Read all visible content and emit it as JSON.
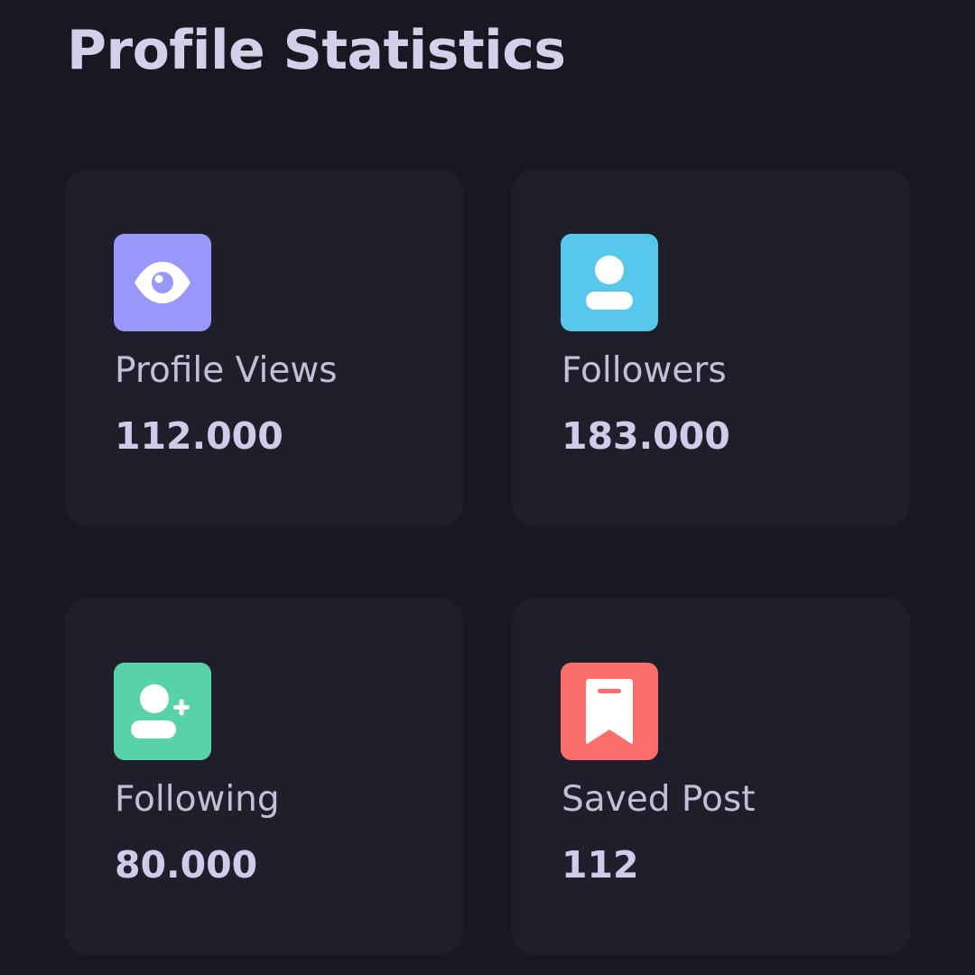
{
  "page": {
    "title": "Profile Statistics"
  },
  "theme": {
    "background": "#181822",
    "card_background": "#1f1f2c",
    "text_primary": "#cfccea",
    "text_secondary": "#c2bfd6"
  },
  "stats": [
    {
      "label": "Profile Views",
      "value": "112.000",
      "icon": "eye-icon",
      "color": "#9a97fb"
    },
    {
      "label": "Followers",
      "value": "183.000",
      "icon": "user-icon",
      "color": "#57c7ec"
    },
    {
      "label": "Following",
      "value": "80.000",
      "icon": "user-plus-icon",
      "color": "#58d3a9"
    },
    {
      "label": "Saved Post",
      "value": "112",
      "icon": "bookmark-icon",
      "color": "#fb6e6c"
    }
  ]
}
